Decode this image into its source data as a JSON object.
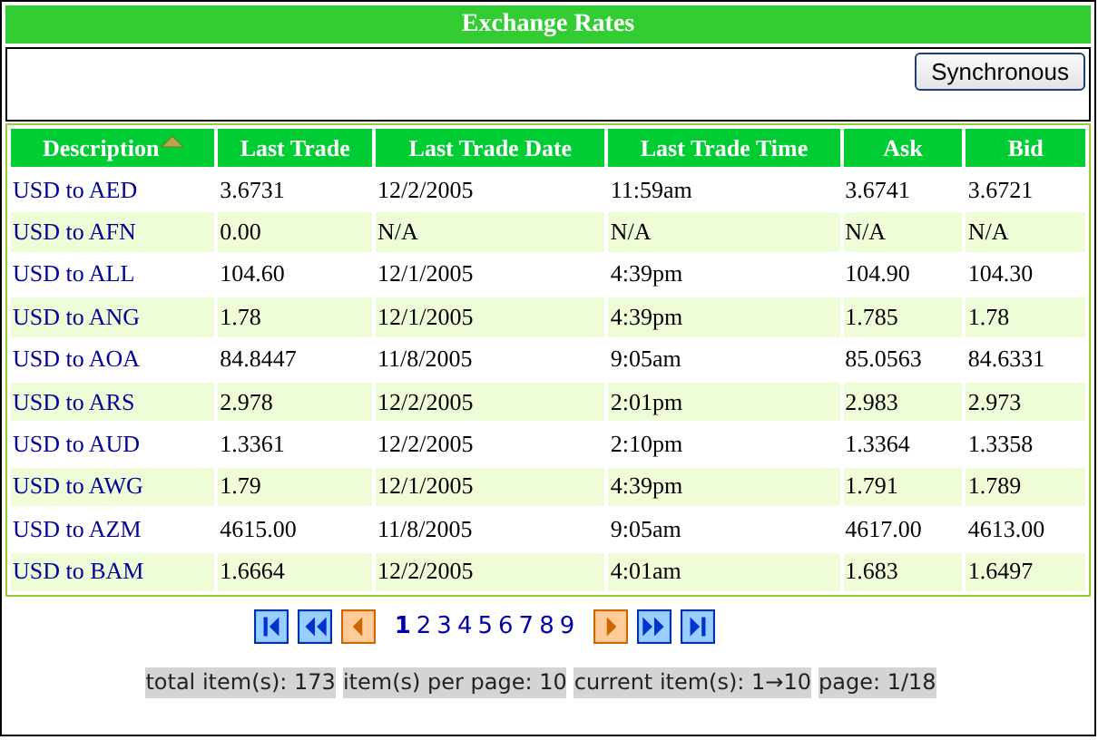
{
  "window": {
    "title": "Exchange Rates"
  },
  "toolbar": {
    "button": "Synchronous"
  },
  "table": {
    "columns": [
      {
        "label": "Description",
        "sorted": true
      },
      {
        "label": "Last Trade",
        "sorted": false
      },
      {
        "label": "Last Trade Date",
        "sorted": false
      },
      {
        "label": "Last Trade Time",
        "sorted": false
      },
      {
        "label": "Ask",
        "sorted": false
      },
      {
        "label": "Bid",
        "sorted": false
      }
    ],
    "rows": [
      [
        "USD to AED",
        "3.6731",
        "12/2/2005",
        "11:59am",
        "3.6741",
        "3.6721"
      ],
      [
        "USD to AFN",
        "0.00",
        "N/A",
        "N/A",
        "N/A",
        "N/A"
      ],
      [
        "USD to ALL",
        "104.60",
        "12/1/2005",
        "4:39pm",
        "104.90",
        "104.30"
      ],
      [
        "USD to ANG",
        "1.78",
        "12/1/2005",
        "4:39pm",
        "1.785",
        "1.78"
      ],
      [
        "USD to AOA",
        "84.8447",
        "11/8/2005",
        "9:05am",
        "85.0563",
        "84.6331"
      ],
      [
        "USD to ARS",
        "2.978",
        "12/2/2005",
        "2:01pm",
        "2.983",
        "2.973"
      ],
      [
        "USD to AUD",
        "1.3361",
        "12/2/2005",
        "2:10pm",
        "1.3364",
        "1.3358"
      ],
      [
        "USD to AWG",
        "1.79",
        "12/1/2005",
        "4:39pm",
        "1.791",
        "1.789"
      ],
      [
        "USD to AZM",
        "4615.00",
        "11/8/2005",
        "9:05am",
        "4617.00",
        "4613.00"
      ],
      [
        "USD to BAM",
        "1.6664",
        "12/2/2005",
        "4:01am",
        "1.683",
        "1.6497"
      ]
    ]
  },
  "pager": {
    "buttons_before": [
      {
        "kind": "first"
      },
      {
        "kind": "fast-back"
      },
      {
        "kind": "back"
      }
    ],
    "pages": [
      {
        "label": "1",
        "selected": true
      },
      {
        "label": "2",
        "selected": false
      },
      {
        "label": "3",
        "selected": false
      },
      {
        "label": "4",
        "selected": false
      },
      {
        "label": "5",
        "selected": false
      },
      {
        "label": "6",
        "selected": false
      },
      {
        "label": "7",
        "selected": false
      },
      {
        "label": "8",
        "selected": false
      },
      {
        "label": "9",
        "selected": false
      }
    ],
    "buttons_after": [
      {
        "kind": "next"
      },
      {
        "kind": "fast-forward"
      },
      {
        "kind": "last"
      }
    ]
  },
  "status": [
    "total item(s): 173",
    "item(s) per page: 10",
    "current item(s): 1→10",
    "page: 1/18"
  ]
}
